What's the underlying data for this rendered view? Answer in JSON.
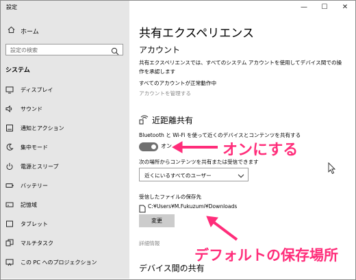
{
  "window": {
    "title": "設定",
    "minimize": "—",
    "maximize": "☐",
    "close": "✕"
  },
  "sidebar": {
    "home": "ホーム",
    "search_placeholder": "設定の検索",
    "section": "システム",
    "items": [
      {
        "label": "ディスプレイ",
        "icon": "display-icon"
      },
      {
        "label": "サウンド",
        "icon": "speaker-icon"
      },
      {
        "label": "通知とアクション",
        "icon": "notification-icon"
      },
      {
        "label": "集中モード",
        "icon": "moon-icon"
      },
      {
        "label": "電源とスリープ",
        "icon": "power-icon"
      },
      {
        "label": "バッテリー",
        "icon": "battery-icon"
      },
      {
        "label": "記憶域",
        "icon": "storage-icon"
      },
      {
        "label": "タブレット",
        "icon": "tablet-icon"
      },
      {
        "label": "マルチタスク",
        "icon": "multitask-icon"
      },
      {
        "label": "この PC へのプロジェクション",
        "icon": "projection-icon"
      }
    ]
  },
  "main": {
    "title": "共有エクスペリエンス",
    "account": {
      "heading": "アカウント",
      "desc_line1": "共有エクスペリエンスでは、すべてのシステム アカウントを使用してデバイス間での操",
      "desc_line2": "作を承認します",
      "status": "すべてのアカウントが正常動作中",
      "manage_link": "アカウントを管理する"
    },
    "nearby": {
      "heading": "近距離共有",
      "description": "Bluetooth と Wi-Fi を使って近くのデバイスとコンテンツを共有する",
      "toggle_label": "オン",
      "toggle_on": true,
      "receive_from_label": "次の場所からコンテンツを共有または受信できます",
      "receive_from_value": "近くにいるすべてのユーザー",
      "saved_files_label": "受信したファイルの保存先",
      "saved_path": "C:¥Users¥M.Fukuzumi¥Downloads",
      "change_button": "変更",
      "details_link": "詳細情報"
    },
    "cross_device_heading": "デバイス間の共有"
  },
  "annotations": {
    "toggle_note": "オンにする",
    "path_note": "デフォルトの保存場所",
    "color": "#ff2d7a"
  }
}
